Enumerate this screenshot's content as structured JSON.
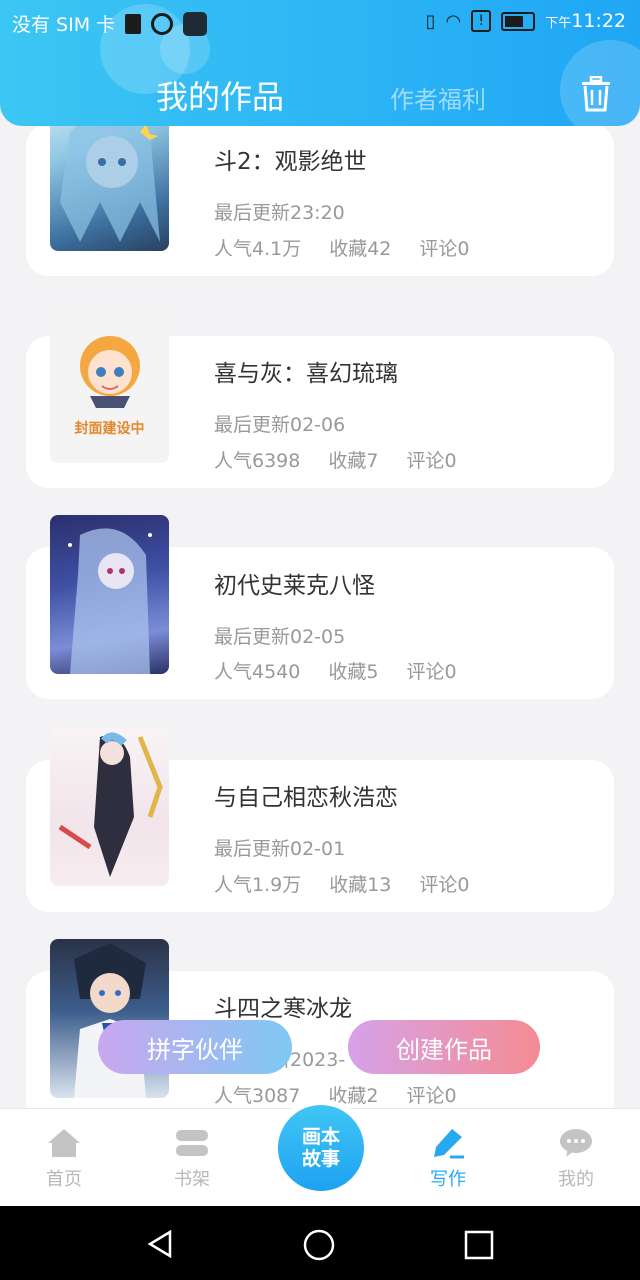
{
  "status_bar": {
    "carrier": "没有 SIM 卡",
    "time_prefix": "下午",
    "time": "11:22"
  },
  "header": {
    "tab_active": "我的作品",
    "tab_inactive": "作者福利",
    "trash_icon": "trash-icon"
  },
  "works": [
    {
      "title": "斗2：观影绝世",
      "updated": "最后更新23:20",
      "popularity": "人气4.1万",
      "favorites": "收藏42",
      "comments": "评论0",
      "cover": "anime-girl-blue"
    },
    {
      "title": "喜与灰：喜幻琉璃",
      "updated": "最后更新02-06",
      "popularity": "人气6398",
      "favorites": "收藏7",
      "comments": "评论0",
      "cover": "placeholder",
      "cover_text": "封面建设中"
    },
    {
      "title": "初代史莱克八怪",
      "updated": "最后更新02-05",
      "popularity": "人气4540",
      "favorites": "收藏5",
      "comments": "评论0",
      "cover": "anime-girl-purple"
    },
    {
      "title": "与自己相恋秋浩恋",
      "updated": "最后更新02-01",
      "popularity": "人气1.9万",
      "favorites": "收藏13",
      "comments": "评论0",
      "cover": "anime-girl-dark"
    },
    {
      "title": "斗四之寒冰龙",
      "updated": "最后更新2023-",
      "popularity": "人气3087",
      "favorites": "收藏2",
      "comments": "评论0",
      "cover": "anime-boy-blue"
    }
  ],
  "fab": {
    "left_label": "拼字伙伴",
    "right_label": "创建作品"
  },
  "bottom_nav": {
    "home": "首页",
    "shelf": "书架",
    "center_line1": "画本",
    "center_line2": "故事",
    "write": "写作",
    "mine": "我的"
  },
  "colors": {
    "accent": "#27a9f2",
    "header_start": "#3cc6f4",
    "header_end": "#1fa6f5"
  }
}
